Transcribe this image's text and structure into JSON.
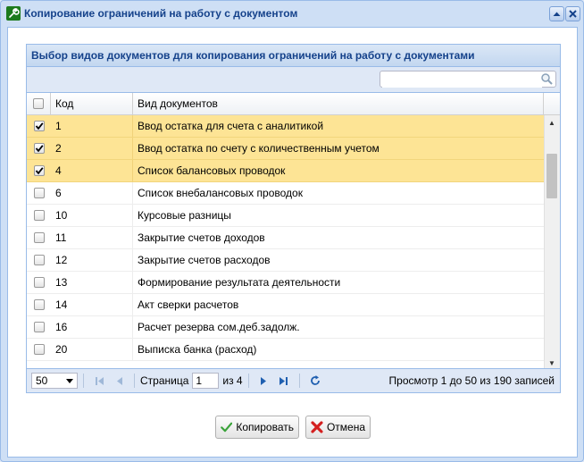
{
  "window": {
    "title": "Копирование ограничений на работу с документом"
  },
  "panel": {
    "title": "Выбор видов документов для копирования ограничений на работу с документами",
    "search": {
      "value": "",
      "placeholder": ""
    }
  },
  "grid": {
    "columns": {
      "code": "Код",
      "name": "Вид документов"
    },
    "rows": [
      {
        "code": "1",
        "name": "Ввод остатка для счета с аналитикой",
        "checked": true
      },
      {
        "code": "2",
        "name": "Ввод остатка по счету с количественным учетом",
        "checked": true
      },
      {
        "code": "4",
        "name": "Список балансовых проводок",
        "checked": true
      },
      {
        "code": "6",
        "name": "Список внебалансовых проводок",
        "checked": false
      },
      {
        "code": "10",
        "name": "Курсовые разницы",
        "checked": false
      },
      {
        "code": "11",
        "name": "Закрытие счетов доходов",
        "checked": false
      },
      {
        "code": "12",
        "name": "Закрытие счетов расходов",
        "checked": false
      },
      {
        "code": "13",
        "name": "Формирование результата деятельности",
        "checked": false
      },
      {
        "code": "14",
        "name": "Акт сверки расчетов",
        "checked": false
      },
      {
        "code": "16",
        "name": "Расчет резерва сом.деб.задолж.",
        "checked": false
      },
      {
        "code": "20",
        "name": "Выписка банка (расход)",
        "checked": false
      }
    ]
  },
  "pager": {
    "page_size": "50",
    "page_label": "Страница",
    "page": "1",
    "of_label": "из 4",
    "info": "Просмотр 1 до 50 из 190 записей"
  },
  "buttons": {
    "copy": "Копировать",
    "cancel": "Отмена"
  },
  "colors": {
    "selected_row": "#fde495",
    "header_text": "#15428b",
    "accent": "#99bbe8"
  }
}
